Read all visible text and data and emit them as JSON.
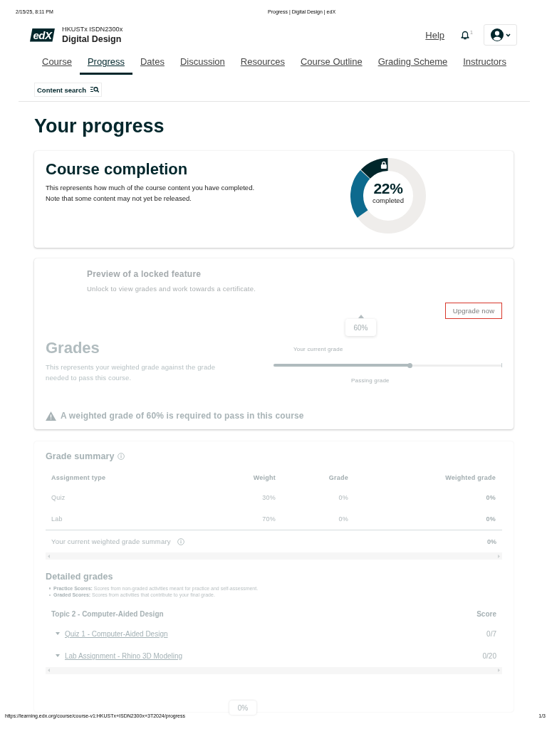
{
  "print_header": {
    "date": "2/15/25, 8:11 PM",
    "title": "Progress | Digital Design | edX"
  },
  "header": {
    "logo": "edX",
    "course_code": "HKUSTx ISDN2300x",
    "course_title": "Digital Design",
    "help": "Help",
    "notification_count": "1"
  },
  "tabs": [
    {
      "label": "Course",
      "selected": false
    },
    {
      "label": "Progress",
      "selected": true
    },
    {
      "label": "Dates",
      "selected": false
    },
    {
      "label": "Discussion",
      "selected": false
    },
    {
      "label": "Resources",
      "selected": false
    },
    {
      "label": "Course Outline",
      "selected": false
    },
    {
      "label": "Grading Scheme",
      "selected": false
    },
    {
      "label": "Instructors",
      "selected": false
    }
  ],
  "content_search": {
    "label": "Content search"
  },
  "page_title": "Your progress",
  "course_completion": {
    "title": "Course completion",
    "description": [
      "This represents how much of the course content you have completed.",
      "Note that some content may not yet be released."
    ],
    "percent": "22%",
    "caption": "completed",
    "segments": [
      {
        "kind": "locked",
        "level": 0.13
      },
      {
        "kind": "completed",
        "level": 0.22
      }
    ]
  },
  "locked_preview": {
    "title": "Preview of a locked feature",
    "message": "Unlock to view grades and work towards a certificate.",
    "button": "Upgrade now"
  },
  "grades": {
    "title": "Grades",
    "description": "This represents your weighted grade against the grade needed to pass this course.",
    "current_grade_label": "Your current grade",
    "tooltip": "60%",
    "level": 0.6,
    "passing_grade_label": "Passing grade",
    "warning": "A weighted grade of 60% is required to pass in this course"
  },
  "grade_summary": {
    "title": "Grade summary",
    "columns": [
      "Assignment type",
      "Weight",
      "Grade",
      "Weighted grade"
    ],
    "rows": [
      {
        "type": "Quiz",
        "weight": "30%",
        "grade": "0%",
        "weighted_grade": "0%"
      },
      {
        "type": "Lab",
        "weight": "70%",
        "grade": "0%",
        "weighted_grade": "0%"
      }
    ],
    "total": {
      "label": "Your current weighted grade summary",
      "value": "0%"
    }
  },
  "detailed_grades": {
    "title": "Detailed grades",
    "notes": [
      "**Practice Scores:** Scores from non-graded activities meant for practice and self-assessment.",
      "**Graded Scores:** Scores from activities that contribute to your final grade."
    ],
    "section": {
      "title": "Topic 2 - Computer-Aided Design",
      "score_label": "Score",
      "items": [
        {
          "title": "Quiz 1 - Computer-Aided Design",
          "score": "0/7"
        },
        {
          "title": "Lab Assignment - Rhino 3D Modeling",
          "score": "0/20"
        }
      ]
    }
  },
  "floating_tooltip": "0%",
  "print_footer": {
    "url": "https://learning.edx.org/course/course-v1:HKUSTx+ISDN2300x+3T2024/progress",
    "page": "1/3"
  }
}
